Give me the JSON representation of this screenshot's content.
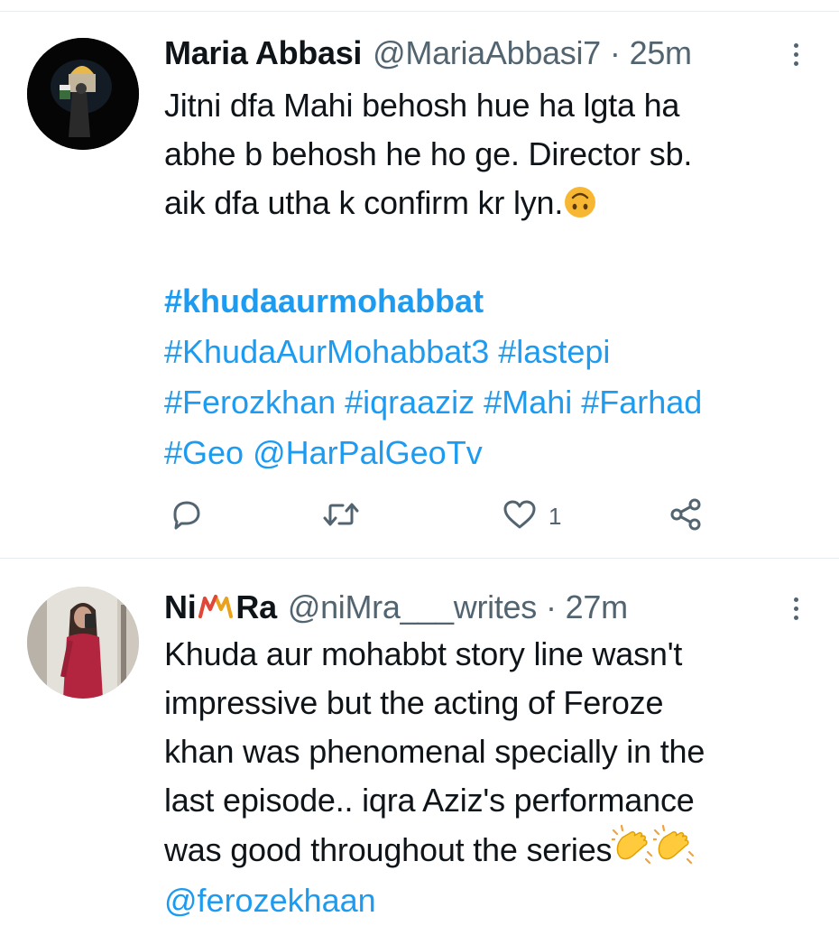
{
  "tweets": [
    {
      "name": "Maria Abbasi",
      "handle": "@MariaAbbasi7",
      "separator": "·",
      "time": "25m",
      "text_lines": [
        "Jitni dfa Mahi behosh hue ha lgta ha",
        "abhe b behosh he ho ge. Director sb.",
        "aik dfa utha k confirm kr lyn."
      ],
      "emoji": "upside-down-face",
      "tag_lines": [
        "#khudaaurmohabbat",
        "#KhudaAurMohabbat3 #lastepi",
        "#Ferozkhan #iqraaziz #Mahi #Farhad",
        "#Geo @HarPalGeoTv"
      ],
      "actions": {
        "reply_icon": "reply-icon",
        "retweet_icon": "retweet-icon",
        "like_icon": "like-icon",
        "like_count": "1",
        "share_icon": "share-icon"
      }
    },
    {
      "name_part1": "Ni",
      "name_part2": "Ra",
      "handle": "@niMra___writes",
      "separator": "·",
      "time": "27m",
      "text_lines": [
        "Khuda aur mohabbt story line wasn't",
        "impressive but the acting of Feroze",
        "khan was phenomenal specially in the",
        "last episode.. iqra Aziz's performance",
        "was good throughout the series"
      ],
      "emoji": "clapping-hands",
      "mention": "@ferozekhaan"
    }
  ],
  "colors": {
    "link": "#1d9bf0",
    "secondary": "#536471",
    "text": "#0f1419",
    "divider": "#e6ecf0"
  }
}
